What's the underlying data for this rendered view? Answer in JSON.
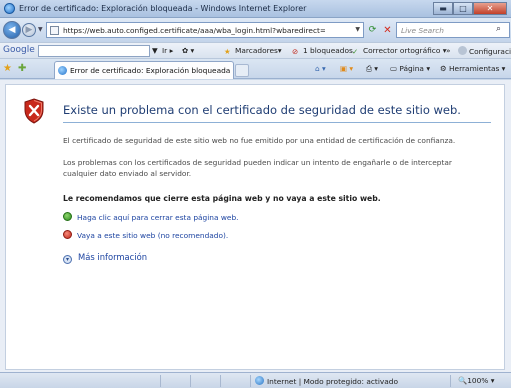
{
  "window": {
    "title": "Error de certificado: Exploración bloqueada - Windows Internet Explorer",
    "minimize_glyph": "▬",
    "maximize_glyph": "□",
    "close_glyph": "✕"
  },
  "addressbar": {
    "url": "https://web.auto.configed.certificate/aaa/wba_login.html?wbaredirect=wba-i",
    "search_placeholder": "Live Search"
  },
  "google_toolbar": {
    "logo": "Google G",
    "ir_label": "Ir",
    "marcadores_label": "Marcadores",
    "bloqueados_label": "1 bloqueados",
    "corrector_label": "Corrector ortográfico",
    "more_glyph": "»",
    "configuracion_label": "Configuración"
  },
  "tabs": [
    {
      "label": "Error de certificado: Exploración bloqueada",
      "active": true
    }
  ],
  "command_bar": {
    "pagina_label": "Página",
    "herramientas_label": "Herramientas"
  },
  "page": {
    "heading": "Existe un problema con el certificado de seguridad de este sitio web.",
    "para1": "El certificado de seguridad de este sitio web no fue emitido por una entidad de certificación de confianza.",
    "para2": "Los problemas con los certificados de seguridad pueden indicar un intento de engañarle o de interceptar cualquier dato enviado al servidor.",
    "recommend": "Le recomendamos que cierre esta página web y no vaya a este sitio web.",
    "close_link": "Haga clic aquí para cerrar esta página web.",
    "continue_link": "Vaya a este sitio web (no recomendado).",
    "more_info": "Más información"
  },
  "statusbar": {
    "zone": "Internet | Modo protegido: activado",
    "zoom": "100%"
  },
  "colors": {
    "heading": "#1f3d73",
    "link": "#1d44a1",
    "shield_red": "#c0271a",
    "ok_green": "#2d8a1e"
  },
  "icons": {
    "back": "back-arrow-icon",
    "forward": "forward-arrow-icon",
    "refresh": "refresh-icon",
    "stop": "stop-icon",
    "search": "search-icon",
    "favorites": "favorites-star-icon",
    "add_favorites": "add-favorites-icon",
    "shield": "shield-x-icon",
    "ok": "green-shield-check-icon",
    "bad": "red-shield-x-icon",
    "globe": "globe-icon"
  }
}
